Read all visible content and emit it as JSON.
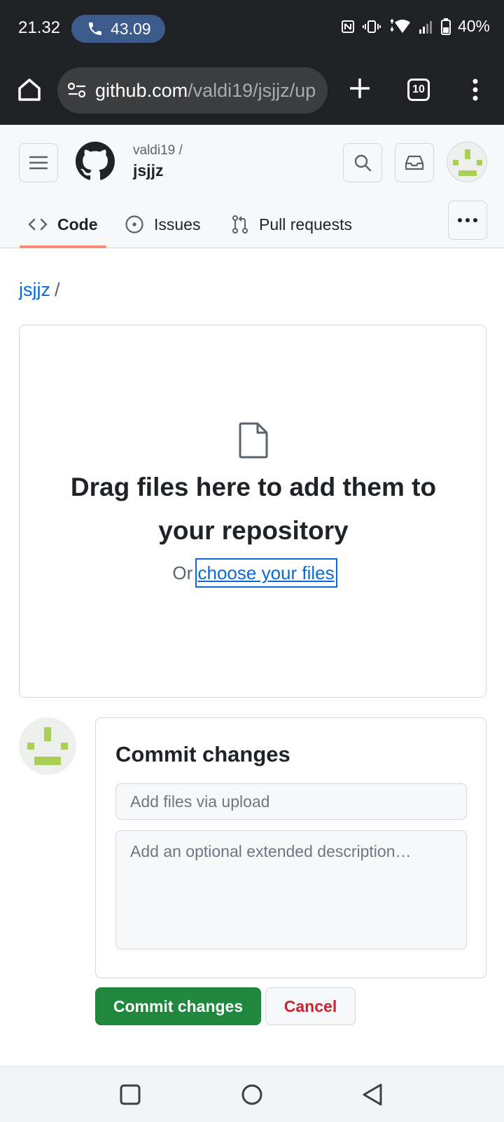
{
  "status_bar": {
    "time": "21.32",
    "call_duration": "43.09",
    "battery": "40%"
  },
  "browser": {
    "url_host": "github.com",
    "url_path": "/valdi19/jsjjz/up",
    "tab_count": "10"
  },
  "header": {
    "owner": "valdi19 /",
    "repo": "jsjjz"
  },
  "tabs": [
    {
      "label": "Code",
      "active": true
    },
    {
      "label": "Issues",
      "active": false
    },
    {
      "label": "Pull requests",
      "active": false
    }
  ],
  "breadcrumb": {
    "repo": "jsjjz",
    "separator": "/"
  },
  "dropzone": {
    "title": "Drag files here to add them to your repository",
    "or_text": "Or",
    "choose_link": "choose your files"
  },
  "commit": {
    "title": "Commit changes",
    "summary_placeholder": "Add files via upload",
    "description_placeholder": "Add an optional extended description…",
    "submit_label": "Commit changes",
    "cancel_label": "Cancel"
  },
  "colors": {
    "accent_link": "#0969da",
    "primary_button": "#1f883d",
    "danger_text": "#cf222e",
    "tab_underline": "#fd8c73",
    "avatar_green": "#a9cf54"
  }
}
